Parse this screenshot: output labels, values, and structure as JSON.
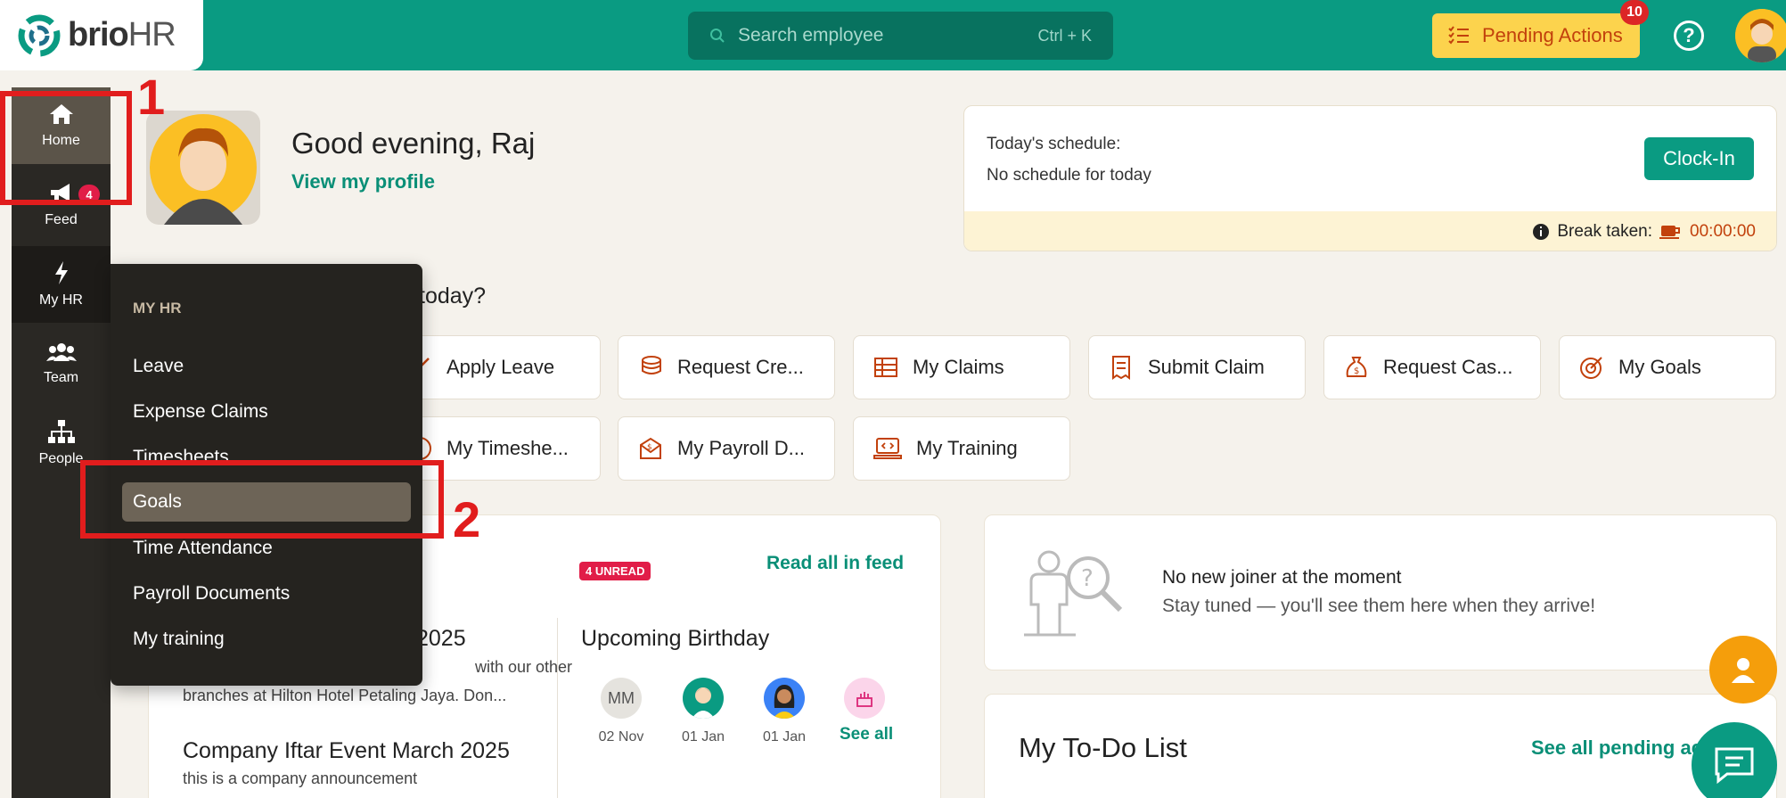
{
  "app": {
    "brand_text": "brio",
    "brand_suffix": "HR",
    "search_placeholder": "Search employee",
    "search_shortcut": "Ctrl + K",
    "pending_label": "Pending Actions",
    "pending_count": "10",
    "help_symbol": "?"
  },
  "sidebar": {
    "items": [
      {
        "label": "Home",
        "icon": "home-icon"
      },
      {
        "label": "Feed",
        "icon": "megaphone-icon",
        "badge": "4"
      },
      {
        "label": "My HR",
        "icon": "bolt-icon"
      },
      {
        "label": "Team",
        "icon": "users-icon"
      },
      {
        "label": "People",
        "icon": "org-chart-icon"
      }
    ]
  },
  "profile": {
    "greeting": "Good evening, Raj",
    "view_profile": "View my profile",
    "question": "today?"
  },
  "schedule": {
    "label": "Today's schedule:",
    "value": "No schedule for today",
    "clock_in": "Clock-In",
    "break_label": "Break taken:",
    "break_time": "00:00:00"
  },
  "quick_actions": {
    "row1": [
      "Apply Leave",
      "Request Cre...",
      "My Claims",
      "Submit Claim",
      "Request Cas...",
      "My Goals"
    ],
    "row2": [
      "My Timeshe...",
      "My Payroll D...",
      "My Training"
    ]
  },
  "announcements": {
    "unread": "4 UNREAD",
    "read_all": "Read all in feed",
    "item1_title_fragment": "2025",
    "item1_line1_fragment": "with our other",
    "item1_line2": "branches at Hilton Hotel Petaling Jaya. Don...",
    "item2_title": "Company Iftar Event March 2025",
    "item2_line": "this is a company announcement"
  },
  "birthdays": {
    "title": "Upcoming Birthday",
    "people": [
      {
        "initials": "MM",
        "date": "02 Nov"
      },
      {
        "initials": "",
        "date": "01 Jan"
      },
      {
        "initials": "",
        "date": "01 Jan"
      }
    ],
    "see_all": "See all"
  },
  "joiners": {
    "line1": "No new joiner at the moment",
    "line2": "Stay tuned — you'll see them here when they arrive!"
  },
  "todo": {
    "title": "My To-Do List",
    "see_all": "See all pending ac"
  },
  "my_hr_menu": {
    "header": "MY HR",
    "items": [
      "Leave",
      "Expense Claims",
      "Timesheets",
      "Goals",
      "Time Attendance",
      "Payroll Documents",
      "My training"
    ],
    "selected": "Goals"
  },
  "annotations": {
    "step1": "1",
    "step2": "2",
    "color": "#e11d1d"
  },
  "colors": {
    "brand_green": "#0a9b82",
    "pending_bg": "#fcd34d",
    "pending_text": "#c2410c",
    "sidebar_bg": "#2a2824",
    "badge_red": "#e11d48",
    "icon_orange": "#c2410c"
  }
}
